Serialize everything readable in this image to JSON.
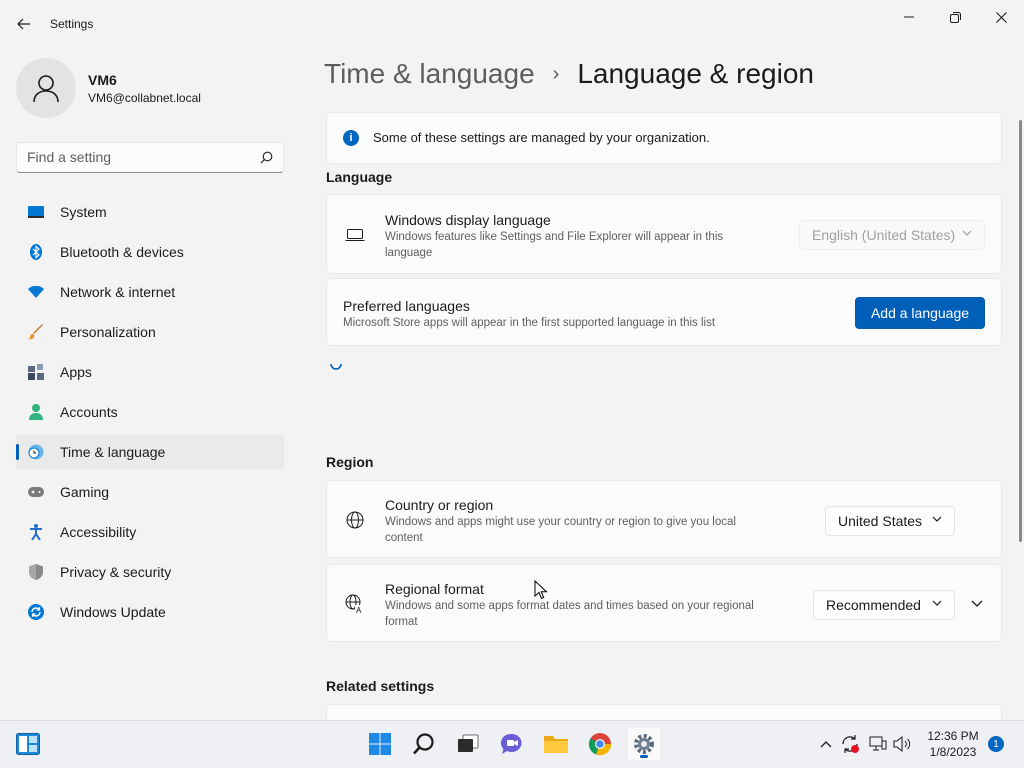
{
  "window": {
    "title": "Settings",
    "controls": [
      "minimize",
      "restore",
      "close"
    ]
  },
  "user": {
    "name": "VM6",
    "email": "VM6@collabnet.local"
  },
  "search": {
    "placeholder": "Find a setting"
  },
  "sidebar": {
    "items": [
      {
        "label": "System",
        "icon": "system-icon",
        "color": "#0078d4"
      },
      {
        "label": "Bluetooth & devices",
        "icon": "bluetooth-icon",
        "color": "#0078d4"
      },
      {
        "label": "Network & internet",
        "icon": "network-icon",
        "color": "#0078d4"
      },
      {
        "label": "Personalization",
        "icon": "brush-icon",
        "color": "#e8912d"
      },
      {
        "label": "Apps",
        "icon": "apps-icon",
        "color": "#5a6a82"
      },
      {
        "label": "Accounts",
        "icon": "accounts-icon",
        "color": "#2fb380"
      },
      {
        "label": "Time & language",
        "icon": "time-language-icon",
        "color": "#0078d4",
        "selected": true
      },
      {
        "label": "Gaming",
        "icon": "gaming-icon",
        "color": "#7a7a7a"
      },
      {
        "label": "Accessibility",
        "icon": "accessibility-icon",
        "color": "#1f6fd1"
      },
      {
        "label": "Privacy & security",
        "icon": "shield-icon",
        "color": "#7a7a7a"
      },
      {
        "label": "Windows Update",
        "icon": "windows-update-icon",
        "color": "#0078d4"
      }
    ]
  },
  "breadcrumb": {
    "parent": "Time & language",
    "separator": "›",
    "current": "Language & region"
  },
  "info_bar": {
    "text": "Some of these settings are managed by your organization."
  },
  "language": {
    "heading": "Language",
    "display": {
      "title": "Windows display language",
      "desc_line1": "Windows features like Settings and File Explorer will appear in this",
      "desc_line2": "language",
      "value": "English (United States)"
    },
    "preferred": {
      "title": "Preferred languages",
      "desc": "Microsoft Store apps will appear in the first supported language in this list",
      "button": "Add a language"
    }
  },
  "region": {
    "heading": "Region",
    "country": {
      "title": "Country or region",
      "desc_line1": "Windows and apps might use your country or region to give you local",
      "desc_line2": "content",
      "value": "United States"
    },
    "format": {
      "title": "Regional format",
      "desc_line1": "Windows and some apps format dates and times based on your regional",
      "desc_line2": "format",
      "value": "Recommended"
    }
  },
  "related": {
    "heading": "Related settings"
  },
  "taskbar": {
    "apps": [
      "widgets",
      "start",
      "search",
      "task-view",
      "chat",
      "file-explorer",
      "chrome",
      "settings"
    ],
    "time": "12:36 PM",
    "date": "1/8/2023",
    "notification_count": "1"
  },
  "colors": {
    "accent": "#005fb8",
    "background": "#f3f3f3",
    "card": "#fbfbfb"
  }
}
